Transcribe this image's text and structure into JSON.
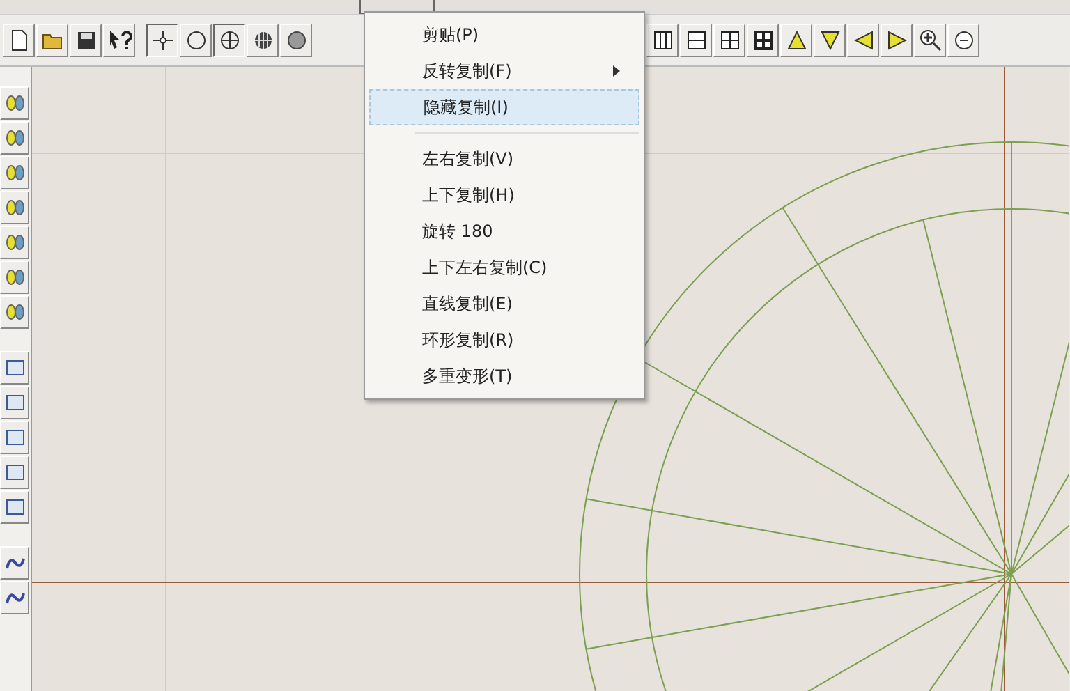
{
  "menu": {
    "items": [
      {
        "kind": "item",
        "label": "剪贴(P)",
        "submenu": false,
        "selected": false
      },
      {
        "kind": "item",
        "label": "反转复制(F)",
        "submenu": true,
        "selected": false
      },
      {
        "kind": "item",
        "label": "隐藏复制(I)",
        "submenu": false,
        "selected": true
      },
      {
        "kind": "separator"
      },
      {
        "kind": "item",
        "label": "左右复制(V)",
        "submenu": false,
        "selected": false
      },
      {
        "kind": "item",
        "label": "上下复制(H)",
        "submenu": false,
        "selected": false
      },
      {
        "kind": "item",
        "label": "旋转 180",
        "submenu": false,
        "selected": false
      },
      {
        "kind": "item",
        "label": "上下左右复制(C)",
        "submenu": false,
        "selected": false
      },
      {
        "kind": "item",
        "label": "直线复制(E)",
        "submenu": false,
        "selected": false
      },
      {
        "kind": "item",
        "label": "环形复制(R)",
        "submenu": false,
        "selected": false
      },
      {
        "kind": "item",
        "label": "多重变形(T)",
        "submenu": false,
        "selected": false
      }
    ]
  }
}
